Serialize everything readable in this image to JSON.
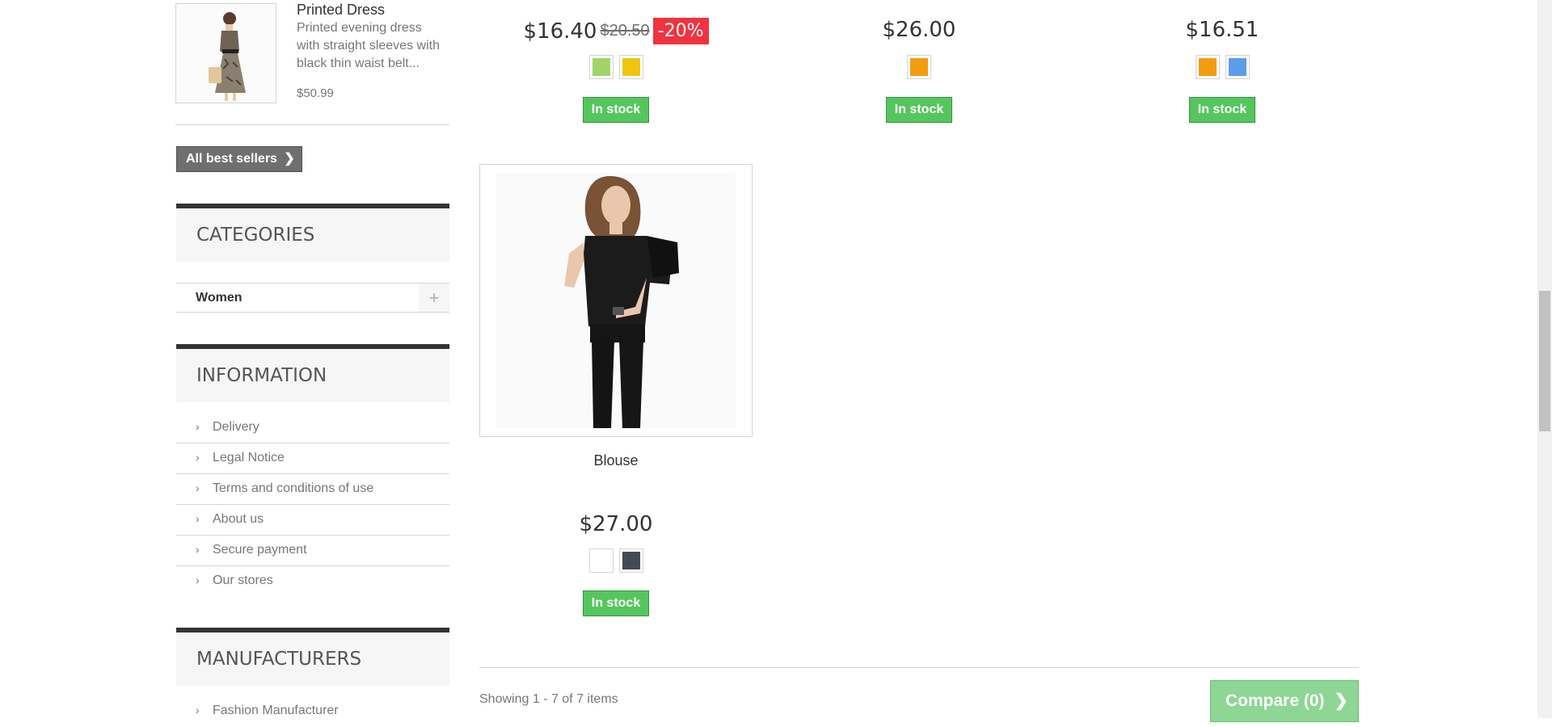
{
  "sidebar": {
    "best_seller": {
      "name": "Printed Dress",
      "description": "Printed evening dress with straight sleeves with black thin waist belt...",
      "price": "$50.99"
    },
    "all_best_sellers_label": "All best sellers",
    "categories": {
      "title": "CATEGORIES",
      "items": [
        {
          "label": "Women",
          "expand_icon": "plus-icon"
        }
      ]
    },
    "information": {
      "title": "INFORMATION",
      "items": [
        {
          "label": "Delivery"
        },
        {
          "label": "Legal Notice"
        },
        {
          "label": "Terms and conditions of use"
        },
        {
          "label": "About us"
        },
        {
          "label": "Secure payment"
        },
        {
          "label": "Our stores"
        }
      ]
    },
    "manufacturers": {
      "title": "MANUFACTURERS",
      "items": [
        {
          "label": "Fashion Manufacturer"
        }
      ]
    }
  },
  "products": [
    {
      "price": "$16.40",
      "old_price": "$20.50",
      "discount": "-20%",
      "colors": [
        "#a0d468",
        "#f1c40f"
      ],
      "availability": "In stock"
    },
    {
      "price": "$26.00",
      "colors": [
        "#f39c11"
      ],
      "availability": "In stock"
    },
    {
      "price": "$16.51",
      "colors": [
        "#f39c11",
        "#5d9cec"
      ],
      "availability": "In stock"
    },
    {
      "name": "Blouse",
      "price": "$27.00",
      "colors": [
        "#ffffff",
        "#434a54"
      ],
      "availability": "In stock"
    }
  ],
  "listing": {
    "showing_text": "Showing 1 - 7 of 7 items",
    "compare_label": "Compare (0)"
  },
  "colors": {
    "in_stock_green": "#55c65e",
    "discount_red": "#f13340",
    "block_dark": "#333333"
  }
}
